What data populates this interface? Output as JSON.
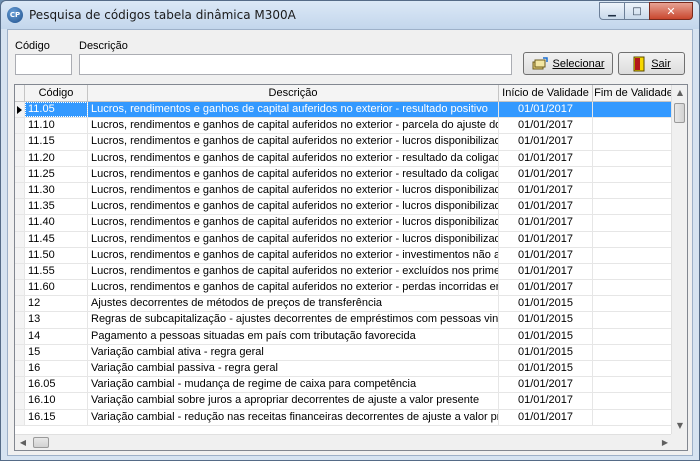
{
  "window": {
    "title": "Pesquisa de códigos tabela dinâmica M300A",
    "app_icon": "CP"
  },
  "filters": {
    "codigo_label": "Código",
    "descricao_label": "Descrição",
    "codigo_value": "",
    "descricao_value": ""
  },
  "buttons": {
    "select_label": "Selecionar",
    "exit_label": "Sair"
  },
  "grid": {
    "headers": [
      "Código",
      "Descrição",
      "Início de Validade",
      "Fim de Validade"
    ],
    "rows": [
      {
        "code": "11.05",
        "desc": "Lucros, rendimentos e ganhos de capital auferidos no exterior - resultado positivo",
        "start": "01/01/2017",
        "end": ""
      },
      {
        "code": "11.10",
        "desc": "Lucros, rendimentos e ganhos de capital auferidos no exterior - parcela do ajuste do va",
        "start": "01/01/2017",
        "end": ""
      },
      {
        "code": "11.15",
        "desc": "Lucros, rendimentos e ganhos de capital auferidos no exterior - lucros disponibilizados",
        "start": "01/01/2017",
        "end": ""
      },
      {
        "code": "11.20",
        "desc": "Lucros, rendimentos e ganhos de capital auferidos no exterior - resultado da coligada",
        "start": "01/01/2017",
        "end": ""
      },
      {
        "code": "11.25",
        "desc": "Lucros, rendimentos e ganhos de capital auferidos no exterior - resultado da coligada r",
        "start": "01/01/2017",
        "end": ""
      },
      {
        "code": "11.30",
        "desc": "Lucros, rendimentos e ganhos de capital auferidos no exterior - lucros disponibilizados",
        "start": "01/01/2017",
        "end": ""
      },
      {
        "code": "11.35",
        "desc": "Lucros, rendimentos e ganhos de capital auferidos no exterior - lucros disponibilizados",
        "start": "01/01/2017",
        "end": ""
      },
      {
        "code": "11.40",
        "desc": "Lucros, rendimentos e ganhos de capital auferidos no exterior - lucros disponibilizados",
        "start": "01/01/2017",
        "end": ""
      },
      {
        "code": "11.45",
        "desc": "Lucros, rendimentos e ganhos de capital auferidos no exterior - lucros disponibilizados",
        "start": "01/01/2017",
        "end": ""
      },
      {
        "code": "11.50",
        "desc": "Lucros, rendimentos e ganhos de capital auferidos no exterior - investimentos não aval",
        "start": "01/01/2017",
        "end": ""
      },
      {
        "code": "11.55",
        "desc": "Lucros, rendimentos e ganhos de capital auferidos no exterior - excluídos nos primeiro,",
        "start": "01/01/2017",
        "end": ""
      },
      {
        "code": "11.60",
        "desc": "Lucros, rendimentos e ganhos de capital auferidos no exterior - perdas incorridas em op",
        "start": "01/01/2017",
        "end": ""
      },
      {
        "code": "12",
        "desc": "Ajustes decorrentes de métodos de preços de transferência",
        "start": "01/01/2015",
        "end": ""
      },
      {
        "code": "13",
        "desc": "Regras de subcapitalização - ajustes decorrentes de empréstimos com pessoas vincula",
        "start": "01/01/2015",
        "end": ""
      },
      {
        "code": "14",
        "desc": "Pagamento a pessoas situadas em país com tributação favorecida",
        "start": "01/01/2015",
        "end": ""
      },
      {
        "code": "15",
        "desc": "Variação cambial ativa - regra geral",
        "start": "01/01/2015",
        "end": ""
      },
      {
        "code": "16",
        "desc": "Variação cambial passiva - regra geral",
        "start": "01/01/2015",
        "end": ""
      },
      {
        "code": "16.05",
        "desc": "Variação cambial - mudança de regime de caixa para competência",
        "start": "01/01/2017",
        "end": ""
      },
      {
        "code": "16.10",
        "desc": "Variação cambial sobre juros a apropriar decorrentes de ajuste a valor presente",
        "start": "01/01/2017",
        "end": ""
      },
      {
        "code": "16.15",
        "desc": "Variação cambial - redução nas receitas financeiras decorrentes de ajuste a valor pres",
        "start": "01/01/2017",
        "end": ""
      }
    ]
  },
  "icons": {
    "minimize": "minimize-icon",
    "maximize": "maximize-icon",
    "close": "close-icon",
    "select": "select-icon",
    "exit": "exit-door-icon"
  },
  "colors": {
    "selection": "#3399ff",
    "titlebar": "#c3d6ec",
    "close_button": "#c9472e"
  }
}
